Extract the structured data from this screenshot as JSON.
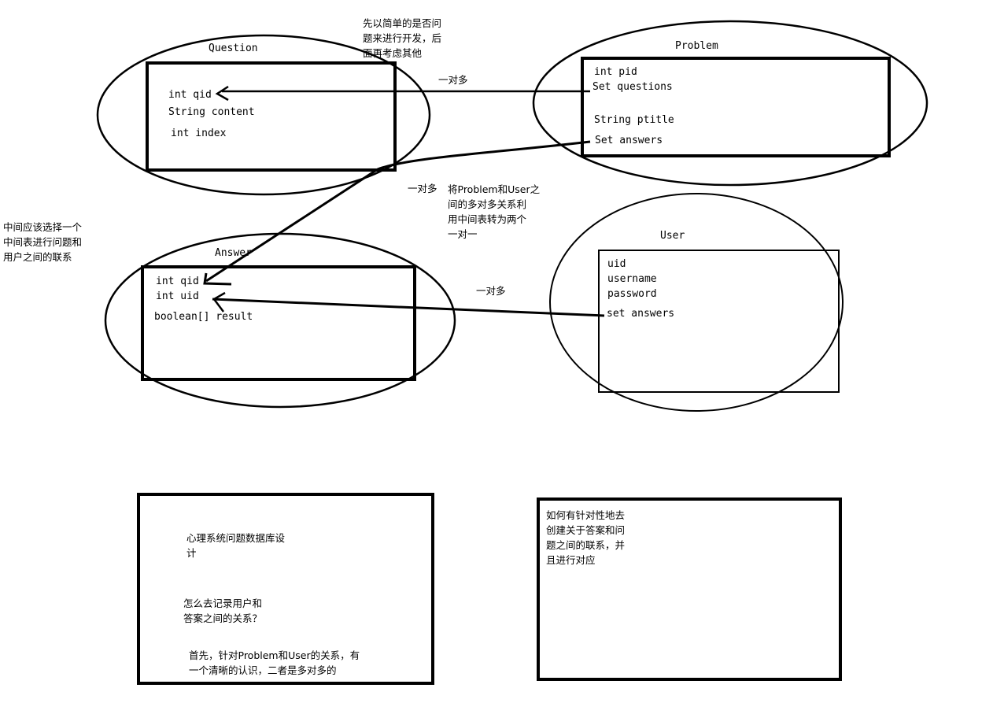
{
  "entities": {
    "question": {
      "title": "Question",
      "fields": [
        "int qid",
        "String content",
        "int index"
      ]
    },
    "problem": {
      "title": "Problem",
      "fields": [
        "int pid",
        "Set questions",
        "String ptitle",
        "Set answers"
      ]
    },
    "answer": {
      "title": "Answer",
      "fields": [
        "int qid",
        "int uid",
        "boolean[]  result"
      ]
    },
    "user": {
      "title": "User",
      "fields": [
        "uid",
        "username",
        "password",
        "set answers"
      ]
    }
  },
  "relations": {
    "problem_question": "一对多",
    "problem_answer": "一对多",
    "user_answer": "一对多"
  },
  "notes": {
    "top": "先以简单的是否问\n题来进行开发，后\n面再考虑其他",
    "left": "中间应该选择一个\n中间表进行问题和\n用户之间的联系",
    "middle": "将Problem和User之\n间的多对多关系利\n用中间表转为两个\n一对一"
  },
  "boxes": {
    "left_title_1": "心理系统问题数据库设",
    "left_title_2": "计",
    "left_q_1": "怎么去记录用户和",
    "left_q_2": "答案之间的关系？",
    "left_a_1": "首先，针对Problem和User的关系，有",
    "left_a_2": "一个清晰的认识，二者是多对多的",
    "right_text": "如何有针对性地去\n创建关于答案和问\n题之间的联系，并\n且进行对应"
  }
}
